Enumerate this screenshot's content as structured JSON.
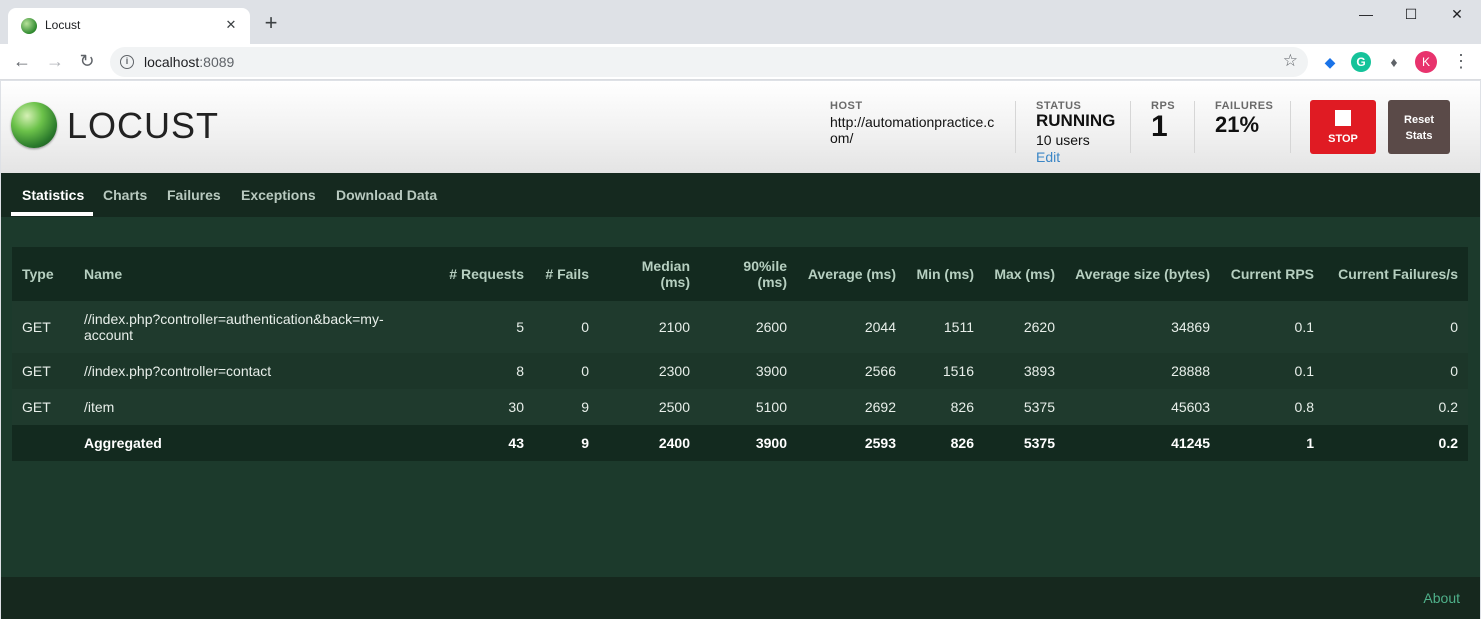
{
  "browser": {
    "tab_title": "Locust",
    "url_host": "localhost",
    "url_port": ":8089",
    "profile_initial": "K"
  },
  "header": {
    "logo_text": "LOCUST",
    "host": {
      "label": "HOST",
      "value": "http://automationpractice.com/"
    },
    "status": {
      "label": "STATUS",
      "value": "RUNNING",
      "users": "10 users",
      "edit": "Edit"
    },
    "rps": {
      "label": "RPS",
      "value": "1"
    },
    "failures": {
      "label": "FAILURES",
      "value": "21%"
    },
    "stop_label": "STOP",
    "reset_label_1": "Reset",
    "reset_label_2": "Stats"
  },
  "nav": {
    "tabs": [
      "Statistics",
      "Charts",
      "Failures",
      "Exceptions",
      "Download Data"
    ],
    "active": "Statistics"
  },
  "table": {
    "headers": [
      "Type",
      "Name",
      "# Requests",
      "# Fails",
      "Median (ms)",
      "90%ile (ms)",
      "Average (ms)",
      "Min (ms)",
      "Max (ms)",
      "Average size (bytes)",
      "Current RPS",
      "Current Failures/s"
    ],
    "rows": [
      [
        "GET",
        "//index.php?controller=authentication&back=my-account",
        "5",
        "0",
        "2100",
        "2600",
        "2044",
        "1511",
        "2620",
        "34869",
        "0.1",
        "0"
      ],
      [
        "GET",
        "//index.php?controller=contact",
        "8",
        "0",
        "2300",
        "3900",
        "2566",
        "1516",
        "3893",
        "28888",
        "0.1",
        "0"
      ],
      [
        "GET",
        "/item",
        "30",
        "9",
        "2500",
        "5100",
        "2692",
        "826",
        "5375",
        "45603",
        "0.8",
        "0.2"
      ]
    ],
    "aggregated": [
      "",
      "Aggregated",
      "43",
      "9",
      "2400",
      "3900",
      "2593",
      "826",
      "5375",
      "41245",
      "1",
      "0.2"
    ]
  },
  "footer": {
    "about": "About"
  },
  "colors": {
    "stop": "#e01b23",
    "reset": "#5a4a48",
    "app_bg": "#1c3a2c",
    "link": "#4fb08a"
  }
}
